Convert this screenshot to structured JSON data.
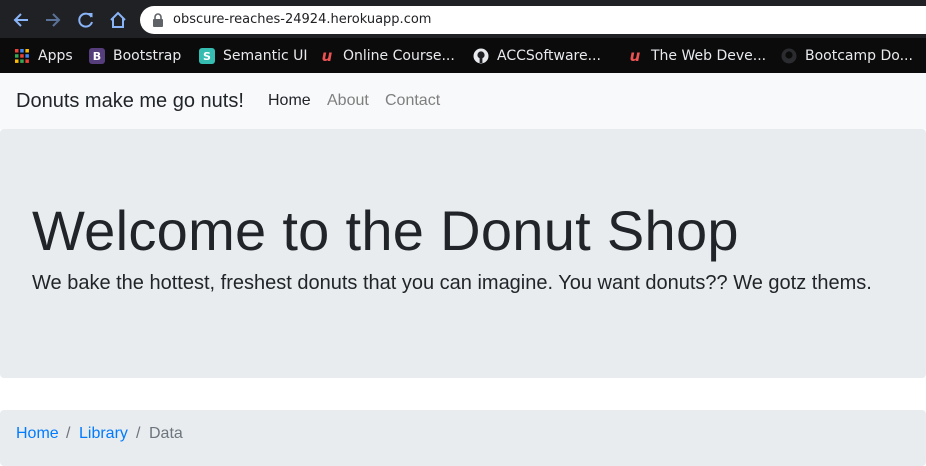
{
  "browser": {
    "url": "obscure-reaches-24924.herokuapp.com",
    "bookmarks": [
      {
        "label": "Apps",
        "icon": "apps-grid-icon"
      },
      {
        "label": "Bootstrap",
        "icon": "bootstrap-icon",
        "glyph": "B"
      },
      {
        "label": "Semantic UI",
        "icon": "semantic-ui-icon",
        "glyph": "S"
      },
      {
        "label": "Online Course...",
        "icon": "udemy-icon",
        "glyph": "u"
      },
      {
        "label": "ACCSoftware...",
        "icon": "github-icon"
      },
      {
        "label": "The Web Deve...",
        "icon": "udemy-icon",
        "glyph": "u"
      },
      {
        "label": "Bootcamp Do...",
        "icon": "github-icon"
      }
    ]
  },
  "navbar": {
    "brand": "Donuts make me go nuts!",
    "links": [
      {
        "label": "Home",
        "active": true
      },
      {
        "label": "About",
        "active": false
      },
      {
        "label": "Contact",
        "active": false
      }
    ]
  },
  "jumbotron": {
    "title": "Welcome to the Donut Shop",
    "lead": "We bake the hottest, freshest donuts that you can imagine. You want donuts?? We gotz thems."
  },
  "breadcrumb": {
    "items": [
      "Home",
      "Library",
      "Data"
    ],
    "separator": "/"
  },
  "colors": {
    "link": "#007bff",
    "muted": "#6c757d",
    "active_nav": "#212529",
    "inactive_nav": "#7f7f7f"
  }
}
